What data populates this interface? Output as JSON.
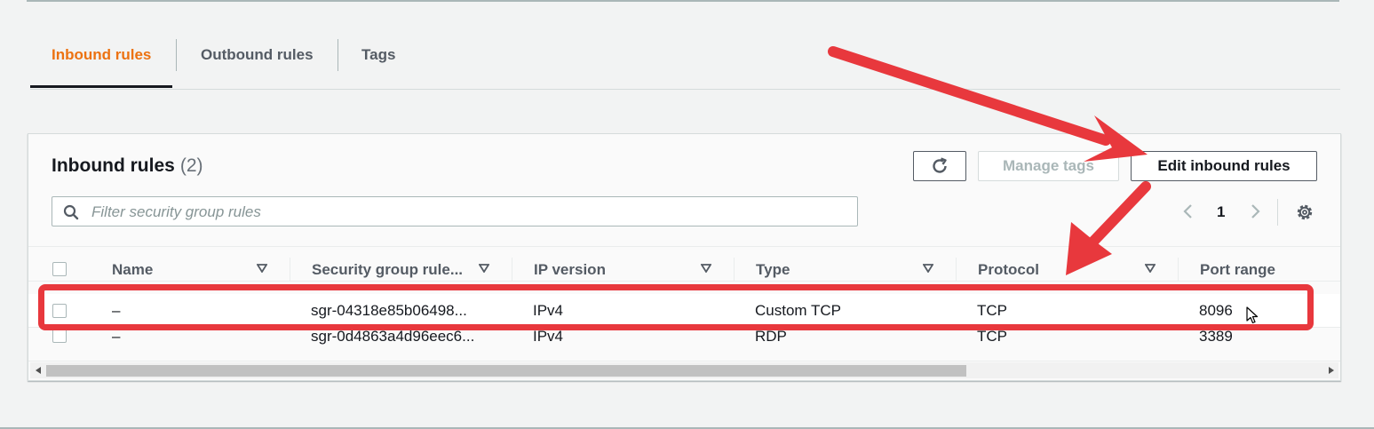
{
  "tabs": [
    {
      "label": "Inbound rules",
      "active": true
    },
    {
      "label": "Outbound rules",
      "active": false
    },
    {
      "label": "Tags",
      "active": false
    }
  ],
  "panel": {
    "title": "Inbound rules",
    "count": "(2)",
    "refresh_icon": "refresh-icon",
    "manage_tags_label": "Manage tags",
    "edit_label": "Edit inbound rules",
    "search_placeholder": "Filter security group rules",
    "search_value": "",
    "page": "1"
  },
  "table": {
    "columns": [
      "Name",
      "Security group rule...",
      "IP version",
      "Type",
      "Protocol",
      "Port range"
    ],
    "rows": [
      {
        "name": "–",
        "rule_id": "sgr-04318e85b06498...",
        "ip_version": "IPv4",
        "type": "Custom TCP",
        "protocol": "TCP",
        "port_range": "8096"
      },
      {
        "name": "–",
        "rule_id": "sgr-0d4863a4d96eec6...",
        "ip_version": "IPv4",
        "type": "RDP",
        "protocol": "TCP",
        "port_range": "3389"
      }
    ]
  },
  "colors": {
    "active_tab": "#ec7211",
    "annotation_red": "#e8383d",
    "text_primary": "#16191f",
    "text_secondary": "#545b64"
  }
}
